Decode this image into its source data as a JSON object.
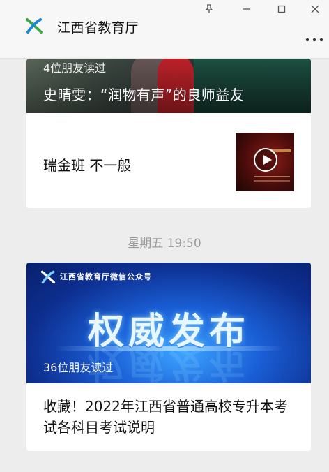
{
  "window": {
    "title": "江西省教育厅",
    "controls": {
      "pin": "pin-icon",
      "minimize": "minimize-icon",
      "maximize": "maximize-icon",
      "close": "close-icon"
    },
    "more": "more-icon"
  },
  "articles": [
    {
      "readers": "4位朋友读过",
      "headline": "史晴雯：“润物有声”的良师益友",
      "sub_title": "瑞金班 不一般",
      "thumb_icon": "play-icon"
    },
    {
      "timestamp": "星期五  19:50",
      "banner_brand": "江西省教育厅微信公众号",
      "banner_text": "权威发布",
      "readers": "36位朋友读过",
      "title": "收藏！2022年江西省普通高校专升本考试各科目考试说明"
    }
  ],
  "colors": {
    "background": "#ededed",
    "card": "#ffffff",
    "accent_green": "#3aa845",
    "accent_blue": "#1a5fd6"
  }
}
